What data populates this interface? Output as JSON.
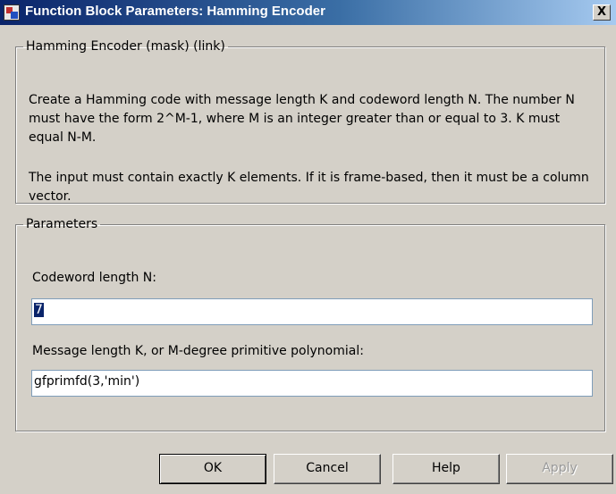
{
  "window": {
    "title": "Function Block Parameters: Hamming Encoder",
    "close_label": "X"
  },
  "description": {
    "legend": "Hamming Encoder (mask) (link)",
    "paragraph1": "Create a Hamming code with message length K and codeword length N.  The number N must have the form 2^M-1, where M is an integer greater than or equal to 3.  K must equal N-M.",
    "paragraph2": "The input must contain exactly K elements.  If it is frame-based, then it must be a column vector."
  },
  "parameters": {
    "legend": "Parameters",
    "codeword_label": "Codeword length N:",
    "codeword_value": "7",
    "message_label": "Message length K, or M-degree primitive polynomial:",
    "message_value": "gfprimfd(3,'min')"
  },
  "buttons": {
    "ok": "OK",
    "cancel": "Cancel",
    "help": "Help",
    "apply": "Apply"
  }
}
